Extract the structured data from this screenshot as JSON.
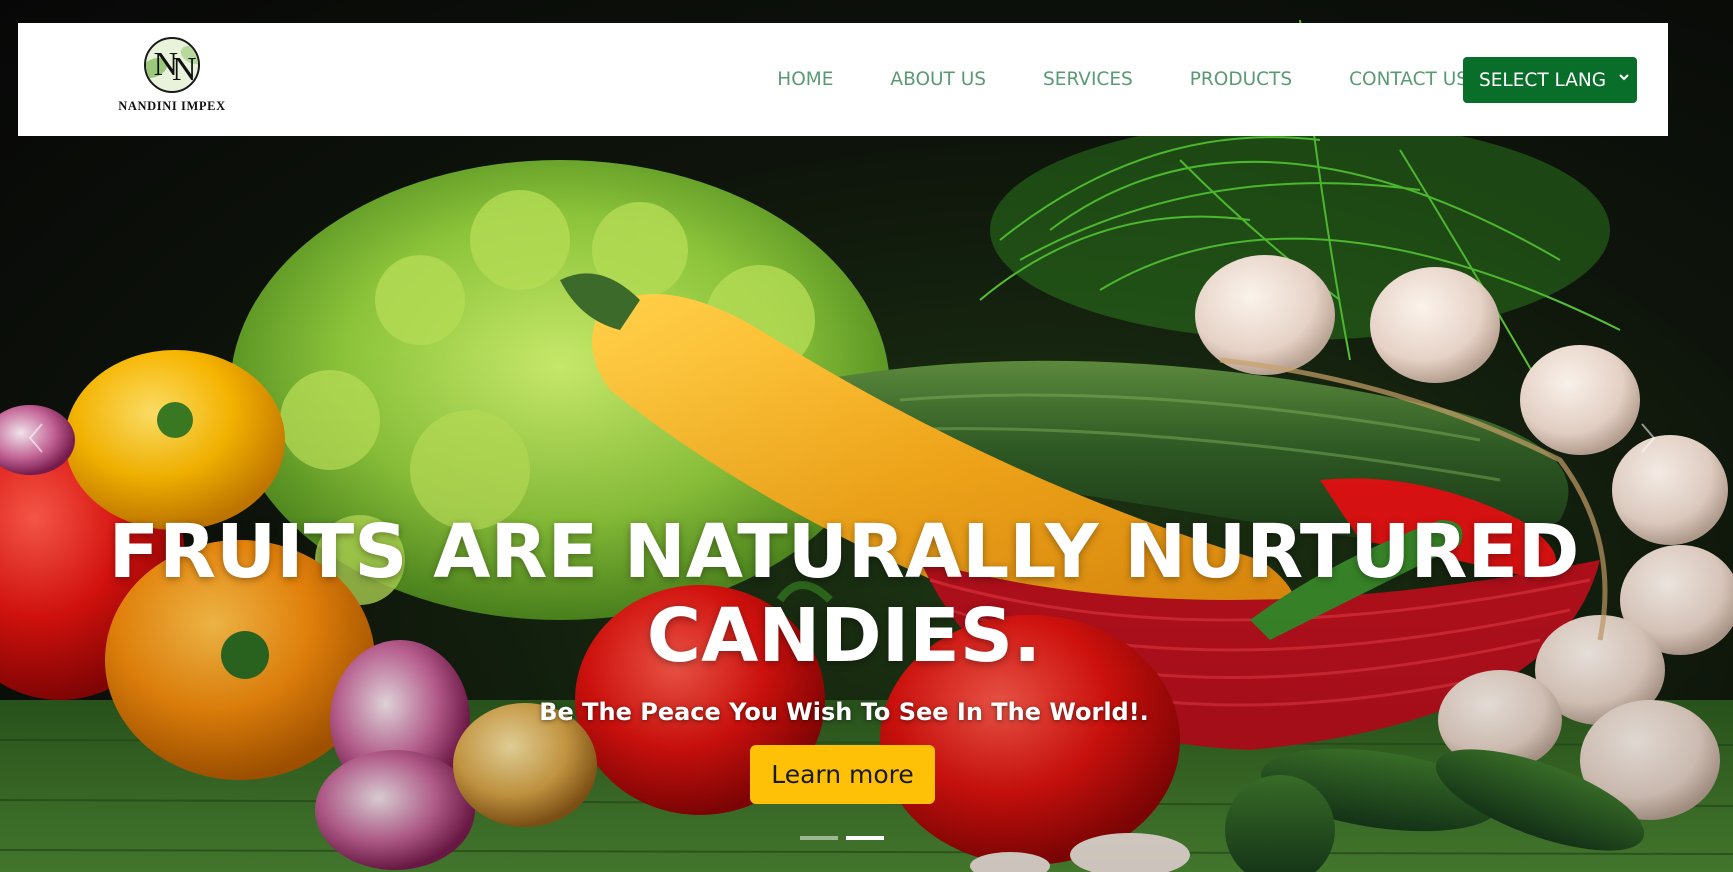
{
  "brand": {
    "name": "NANDINI IMPEX",
    "monogram": "N",
    "logo_icon": "leaf-monogram-logo"
  },
  "nav": {
    "items": [
      {
        "label": "HOME"
      },
      {
        "label": "ABOUT US"
      },
      {
        "label": "SERVICES"
      },
      {
        "label": "PRODUCTS"
      },
      {
        "label": "CONTACT US"
      }
    ],
    "language_select": {
      "label": "SELECT LANG",
      "icon": "chevron-down-icon"
    }
  },
  "hero": {
    "headline_line1": "FRUITS ARE NATURALLY NURTURED",
    "headline_line2": "CANDIES.",
    "subheadline": "Be The Peace You Wish To See In The World!.",
    "cta_label": "Learn more",
    "slide_count": 2,
    "active_slide": 2
  },
  "colors": {
    "nav_text": "#5a9a73",
    "lang_button_bg": "#0a6e2b",
    "cta_bg": "#ffc107",
    "header_bg": "#ffffff"
  }
}
